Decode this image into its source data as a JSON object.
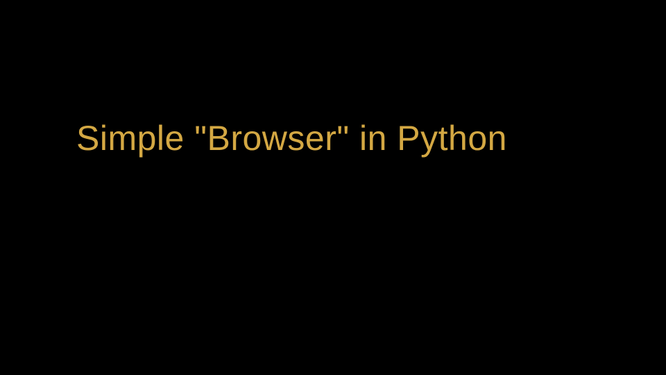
{
  "slide": {
    "title": "Simple \"Browser\" in Python"
  },
  "colors": {
    "background": "#000000",
    "title": "#d4a843"
  }
}
